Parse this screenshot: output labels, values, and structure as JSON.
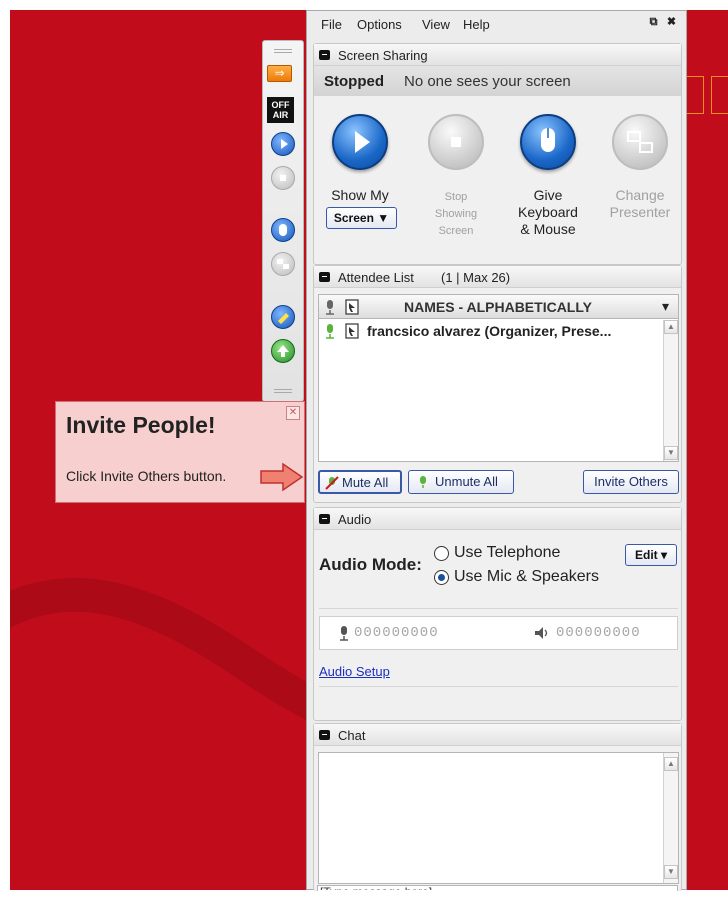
{
  "menu": {
    "file": "File",
    "options": "Options",
    "view": "View",
    "help": "Help"
  },
  "window_buttons": {
    "popout": "⧉",
    "close": "✖"
  },
  "toolbar": {
    "off_air": "OFF AIR",
    "arrow": "⇒"
  },
  "screen_sharing": {
    "title": "Screen Sharing",
    "status": "Stopped",
    "status_message": "No one sees your screen",
    "buttons": {
      "show_my": "Show My",
      "screen_select": "Screen ▼",
      "stop_1": "Stop",
      "stop_2": "Showing",
      "stop_3": "Screen",
      "give_1": "Give",
      "give_2": "Keyboard",
      "give_3": "& Mouse",
      "change_1": "Change",
      "change_2": "Presenter"
    }
  },
  "attendee_list": {
    "title": "Attendee List",
    "count": "(1 | Max 26)",
    "column_header": "NAMES - ALPHABETICALLY",
    "dropdown_arrow": "▾",
    "attendees": [
      {
        "name": "francsico alvarez (Organizer, Prese..."
      }
    ],
    "mute_all": "Mute All",
    "unmute_all": "Unmute All",
    "invite_others": "Invite Others"
  },
  "audio": {
    "title": "Audio",
    "mode_label": "Audio Mode:",
    "option_telephone": "Use Telephone",
    "option_mic": "Use Mic & Speakers",
    "edit": "Edit ▾",
    "mic_level": "000000000",
    "speaker_level": "000000000",
    "setup_link": "Audio Setup"
  },
  "chat": {
    "title": "Chat",
    "input_placeholder": "[Type message here]"
  },
  "callout": {
    "title": "Invite People!",
    "message": "Click Invite Others button.",
    "close": "✕"
  },
  "colors": {
    "background_red": "#c10d1b",
    "accent_blue": "#1a67c8",
    "callout_pink": "#f7cfcf",
    "orange": "#ee7a06"
  }
}
